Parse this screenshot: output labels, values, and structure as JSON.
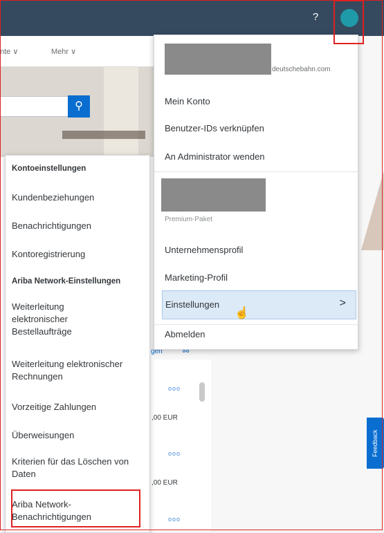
{
  "topbar": {
    "help_icon": "question-circle-icon",
    "avatar_color": "#1f9aa8",
    "bar_color": "#354a5f"
  },
  "subnav": {
    "item1": "nte ∨",
    "item2": "Mehr ∨"
  },
  "search": {
    "icon": "search-icon"
  },
  "user_menu": {
    "email_suffix": "deutschebahn.com",
    "items_top": [
      "Mein Konto",
      "Benutzer-IDs verknüpfen",
      "An Administrator wenden"
    ],
    "premium": "Premium-Paket",
    "items_bottom": [
      "Unternehmensprofil",
      "Marketing-Profil"
    ],
    "settings": "Einstellungen",
    "logout": "Abmelden"
  },
  "settings_menu": {
    "header1": "Kontoeinstellungen",
    "group1": [
      "Kundenbeziehungen",
      "Benachrichtigungen",
      "Kontoregistrierung"
    ],
    "header2": "Ariba Network-Einstellungen",
    "group2": [
      "Weiterleitung elektronischer Bestellaufträge",
      "Weiterleitung elektronischer Rechnungen",
      "Vorzeitige Zahlungen",
      "Überweisungen",
      "Kriterien für das Löschen von Daten",
      "Ariba Network-Benachrichtigungen"
    ]
  },
  "background": {
    "segment_label": "gen",
    "amount1": ",00 EUR",
    "amount2": ",00 EUR",
    "dots": "ooo"
  },
  "feedback": "Feedback"
}
